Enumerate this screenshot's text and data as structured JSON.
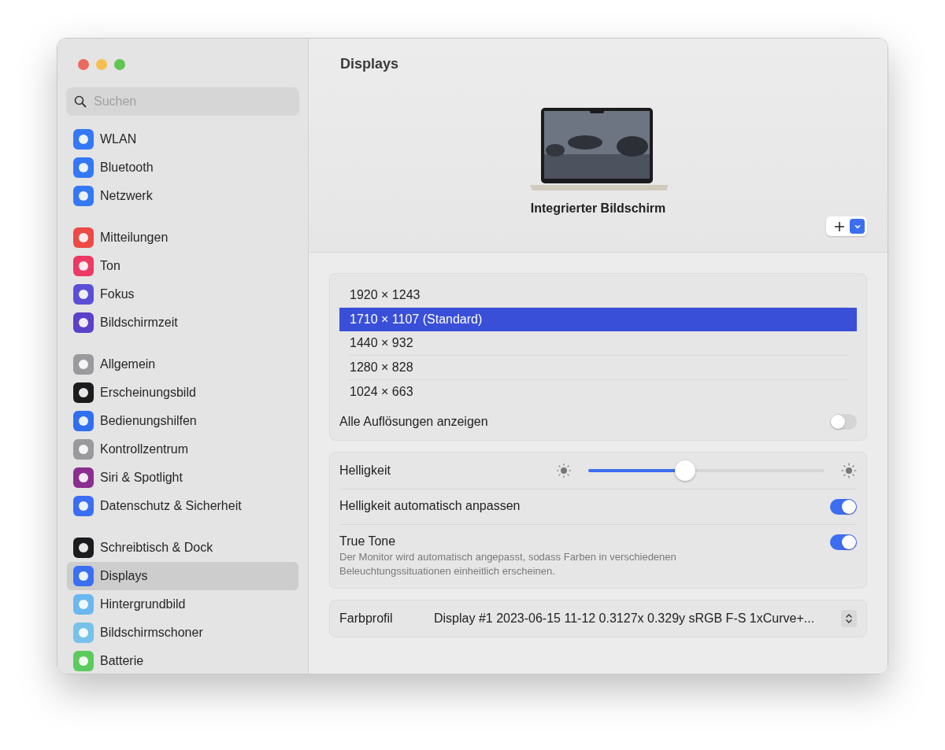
{
  "sidebar": {
    "search": {
      "placeholder": "Suchen"
    },
    "groups": [
      [
        {
          "label": "WLAN",
          "color": "#3478f6",
          "selected": false
        },
        {
          "label": "Bluetooth",
          "color": "#3478f6",
          "selected": false
        },
        {
          "label": "Netzwerk",
          "color": "#3478f6",
          "selected": false
        }
      ],
      [
        {
          "label": "Mitteilungen",
          "color": "#ec4a45",
          "selected": false
        },
        {
          "label": "Ton",
          "color": "#eb3a63",
          "selected": false
        },
        {
          "label": "Fokus",
          "color": "#5b4fd6",
          "selected": false
        },
        {
          "label": "Bildschirmzeit",
          "color": "#5b40c8",
          "selected": false
        }
      ],
      [
        {
          "label": "Allgemein",
          "color": "#9a9a9e",
          "selected": false
        },
        {
          "label": "Erscheinungsbild",
          "color": "#1c1c1e",
          "selected": false
        },
        {
          "label": "Bedienungshilfen",
          "color": "#2f6ff0",
          "selected": false
        },
        {
          "label": "Kontrollzentrum",
          "color": "#9a9a9e",
          "selected": false
        },
        {
          "label": "Siri & Spotlight",
          "color": "#8a2f8f",
          "selected": false
        },
        {
          "label": "Datenschutz & Sicherheit",
          "color": "#3a6ff2",
          "selected": false
        }
      ],
      [
        {
          "label": "Schreibtisch & Dock",
          "color": "#1c1c1e",
          "selected": false
        },
        {
          "label": "Displays",
          "color": "#3a6ff2",
          "selected": true
        },
        {
          "label": "Hintergrundbild",
          "color": "#6bb8ef",
          "selected": false
        },
        {
          "label": "Bildschirmschoner",
          "color": "#77c2ea",
          "selected": false
        },
        {
          "label": "Batterie",
          "color": "#5ccb5f",
          "selected": false
        }
      ]
    ]
  },
  "main": {
    "title": "Displays",
    "display_name": "Integrierter Bildschirm",
    "resolutions": [
      {
        "label": "1920 × 1243",
        "selected": false
      },
      {
        "label": "1710 × 1107 (Standard)",
        "selected": true
      },
      {
        "label": "1440 × 932",
        "selected": false
      },
      {
        "label": "1280 × 828",
        "selected": false
      },
      {
        "label": "1024 × 663",
        "selected": false
      }
    ],
    "show_all": {
      "label": "Alle Auflösungen anzeigen",
      "on": false
    },
    "settings": [
      {
        "kind": "slider",
        "label": "Helligkeit",
        "level": 0.41
      },
      {
        "kind": "toggle",
        "label": "Helligkeit automatisch anpassen",
        "on": true
      },
      {
        "kind": "toggle",
        "label": "True Tone",
        "on": true,
        "description": "Der Monitor wird automatisch angepasst, sodass Farben in verschiedenen Beleuchtungssituationen einheitlich erscheinen."
      }
    ],
    "color_profile": {
      "label": "Farbprofil",
      "value": "Display #1 2023-06-15 11-12 0.3127x 0.329y sRGB F-S 1xCurve+..."
    }
  }
}
